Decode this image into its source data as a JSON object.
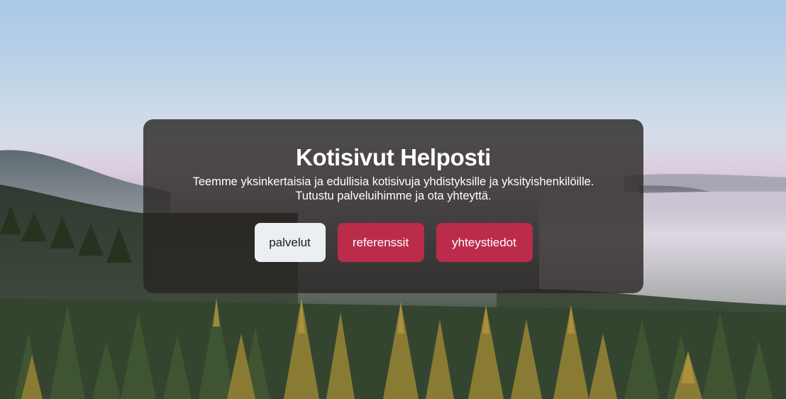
{
  "hero": {
    "title": "Kotisivut Helposti",
    "subtitle_line1": "Teemme yksinkertaisia ja edullisia kotisivuja yhdistyksille ja yksityishenkilöille.",
    "subtitle_line2": "Tutustu palveluihimme ja ota yhteyttä.",
    "background": "forest-fog-landscape"
  },
  "buttons": {
    "services": "palvelut",
    "references": "referenssit",
    "contact": "yhteystiedot"
  },
  "colors": {
    "accent": "#bb2c4b",
    "light_button": "#eceff1",
    "panel": "rgba(40,36,34,0.80)"
  }
}
